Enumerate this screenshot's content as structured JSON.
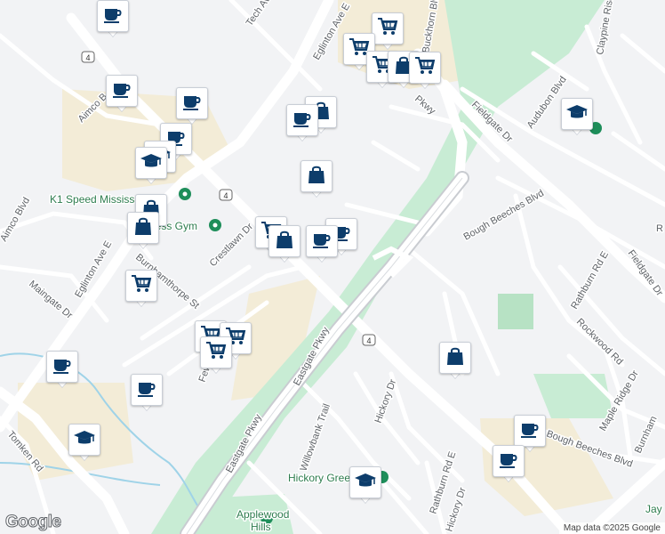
{
  "map": {
    "labels": {
      "tech_ave": "Tech Ave",
      "eglinton_ave_e_top": "Eglinton Ave E",
      "eglinton_ave_e_left": "Eglinton Ave E",
      "aimco_b": "Aimco B",
      "aimco_blvd": "Aimco Blvd",
      "k1_speed": "K1 Speed Mississauga",
      "fit_gym": "Fit4Less Gym",
      "crestlawn_dr": "Crestlawn Dr",
      "burnhamthorpe_st": "Burnhamthorpe St",
      "maingate_dr": "Maingate Dr",
      "buckhorn_blvd": "Buckhorn Blvd",
      "pkwy_top": "Pkwy",
      "fieldgate_dr_top": "Fieldgate Dr",
      "audubon_blvd": "Audubon Blvd",
      "claypine_rise": "Claypine Rise",
      "bough_beeches_blvd_top": "Bough Beeches Blvd",
      "rathburn_rd_e_top": "Rathburn Rd E",
      "fieldgate_dr_right": "Fieldgate Dr",
      "rockwood_rd": "Rockwood Rd",
      "maple_ridge_dr": "Maple Ridge Dr",
      "bough_beeches_blvd_bottom": "Bough Beeches Blvd",
      "burnhamthorpe_right": "Burnham",
      "eastgate_pkwy_mid": "Eastgate Pkwy",
      "eastgate_pkwy_low": "Eastgate Pkwy",
      "hickory_dr": "Hickory Dr",
      "willowbank_trail": "Willowbank Trail",
      "hickory_green": "Hickory Green",
      "rathburn_rd_e_bottom": "Rathburn Rd E",
      "hickory_dr_bottom": "Hickory Dr",
      "tomken_rd": "Tomken Rd",
      "applewood_hills_1": "Applewood",
      "applewood_hills_2": "Hills",
      "jay": "Jay",
      "r_edge": "R",
      "few": "Few",
      "route_4_a": "4",
      "route_4_b": "4",
      "route_4_c": "4"
    },
    "markers": [
      {
        "name": "cafe-marker",
        "icon": "coffee-cup-icon"
      },
      {
        "name": "shopping-cart-marker",
        "icon": "shopping-cart-icon"
      },
      {
        "name": "shopping-cart-marker",
        "icon": "shopping-cart-icon"
      },
      {
        "name": "shopping-cart-marker",
        "icon": "shopping-cart-icon"
      },
      {
        "name": "shopping-bag-marker",
        "icon": "shopping-bag-icon"
      },
      {
        "name": "shopping-cart-marker",
        "icon": "shopping-cart-icon"
      },
      {
        "name": "cafe-marker",
        "icon": "coffee-cup-icon"
      },
      {
        "name": "cafe-marker",
        "icon": "coffee-cup-icon"
      },
      {
        "name": "shopping-bag-marker",
        "icon": "shopping-bag-icon"
      },
      {
        "name": "cafe-marker",
        "icon": "coffee-cup-icon"
      },
      {
        "name": "cafe-marker",
        "icon": "coffee-cup-icon"
      },
      {
        "name": "school-marker",
        "icon": "graduation-cap-icon"
      },
      {
        "name": "school-marker",
        "icon": "graduation-cap-icon"
      },
      {
        "name": "shopping-bag-marker",
        "icon": "shopping-bag-icon"
      },
      {
        "name": "shopping-bag-marker",
        "icon": "shopping-bag-icon"
      },
      {
        "name": "shopping-bag-marker",
        "icon": "shopping-bag-icon"
      },
      {
        "name": "shopping-cart-marker",
        "icon": "shopping-cart-icon"
      },
      {
        "name": "shopping-bag-marker",
        "icon": "shopping-bag-icon"
      },
      {
        "name": "cafe-marker",
        "icon": "coffee-cup-icon"
      },
      {
        "name": "cafe-marker",
        "icon": "coffee-cup-icon"
      },
      {
        "name": "shopping-cart-marker",
        "icon": "shopping-cart-icon"
      },
      {
        "name": "shopping-cart-marker",
        "icon": "shopping-cart-icon"
      },
      {
        "name": "shopping-cart-marker",
        "icon": "shopping-cart-icon"
      },
      {
        "name": "shopping-cart-marker",
        "icon": "shopping-cart-icon"
      },
      {
        "name": "cafe-marker",
        "icon": "coffee-cup-icon"
      },
      {
        "name": "cafe-marker",
        "icon": "coffee-cup-icon"
      },
      {
        "name": "school-marker",
        "icon": "graduation-cap-icon"
      },
      {
        "name": "shopping-bag-marker",
        "icon": "shopping-bag-icon"
      },
      {
        "name": "school-marker",
        "icon": "graduation-cap-icon"
      },
      {
        "name": "school-marker",
        "icon": "graduation-cap-icon"
      },
      {
        "name": "cafe-marker",
        "icon": "coffee-cup-icon"
      },
      {
        "name": "cafe-marker",
        "icon": "coffee-cup-icon"
      }
    ],
    "colors": {
      "marker_icon": "#0d3d6b",
      "road": "#ffffff",
      "highway": "#c9ccd1",
      "park": "#c8ecd4",
      "commercial": "#f3ecd7",
      "water": "#9fd3e8",
      "poi_green": "#1e8e5a"
    }
  },
  "footer": {
    "logo": "Google",
    "attribution": "Map data ©2025 Google"
  }
}
